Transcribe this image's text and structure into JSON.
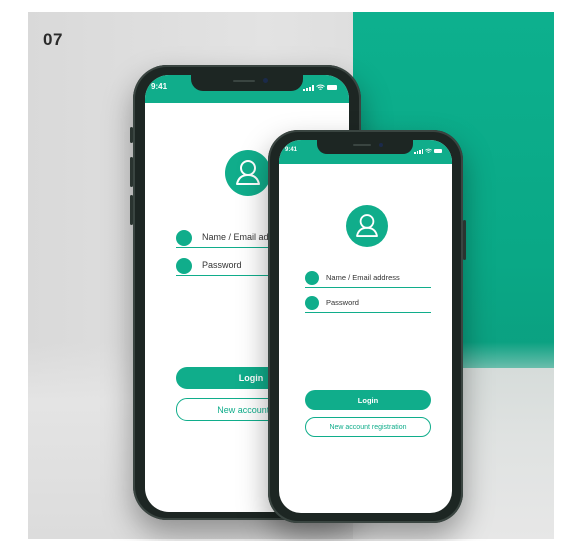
{
  "page_number": "07",
  "colors": {
    "accent": "#10ad8b",
    "phone_frame": "#1d2623",
    "background_green": "#0db08e"
  },
  "back_phone": {
    "status_time": "9:41",
    "avatar_icon": "user-icon",
    "fields": [
      {
        "label": "Name / Email ad"
      },
      {
        "label": "Password"
      }
    ],
    "login_label": "Login",
    "register_label": "New account reg"
  },
  "front_phone": {
    "status_time": "9:41",
    "avatar_icon": "user-icon",
    "fields": [
      {
        "label": "Name / Email address"
      },
      {
        "label": "Password"
      }
    ],
    "login_label": "Login",
    "register_label": "New account registration"
  }
}
